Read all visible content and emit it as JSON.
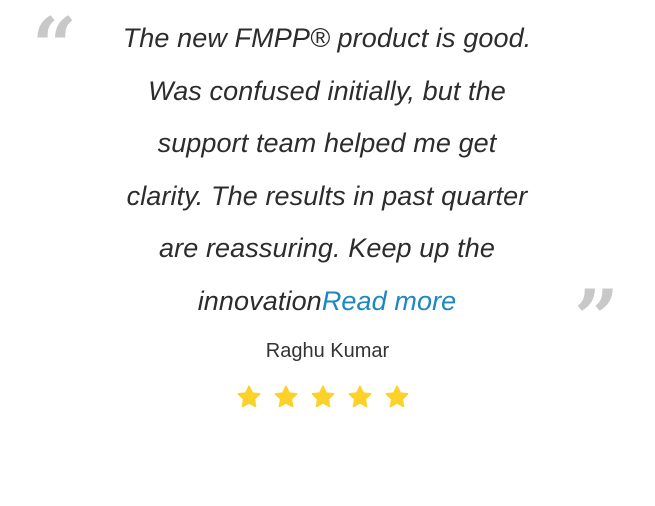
{
  "testimonial": {
    "quote_lines": [
      "The new FMPP® product is good.",
      "Was confused initially, but the",
      "support team helped me get",
      "clarity. The results in past quarter",
      "are reassuring. Keep up the",
      "innovation"
    ],
    "read_more_label": "Read more",
    "author": "Raghu Kumar",
    "rating": 5,
    "rating_max": 5
  },
  "colors": {
    "quote_text": "#2c2c2c",
    "read_more": "#1c87c0",
    "quote_marks": "#c8c8c8",
    "star": "#fcd12a"
  },
  "icons": {
    "open_quote": "open-quote-icon",
    "close_quote": "close-quote-icon",
    "star": "star-icon"
  }
}
